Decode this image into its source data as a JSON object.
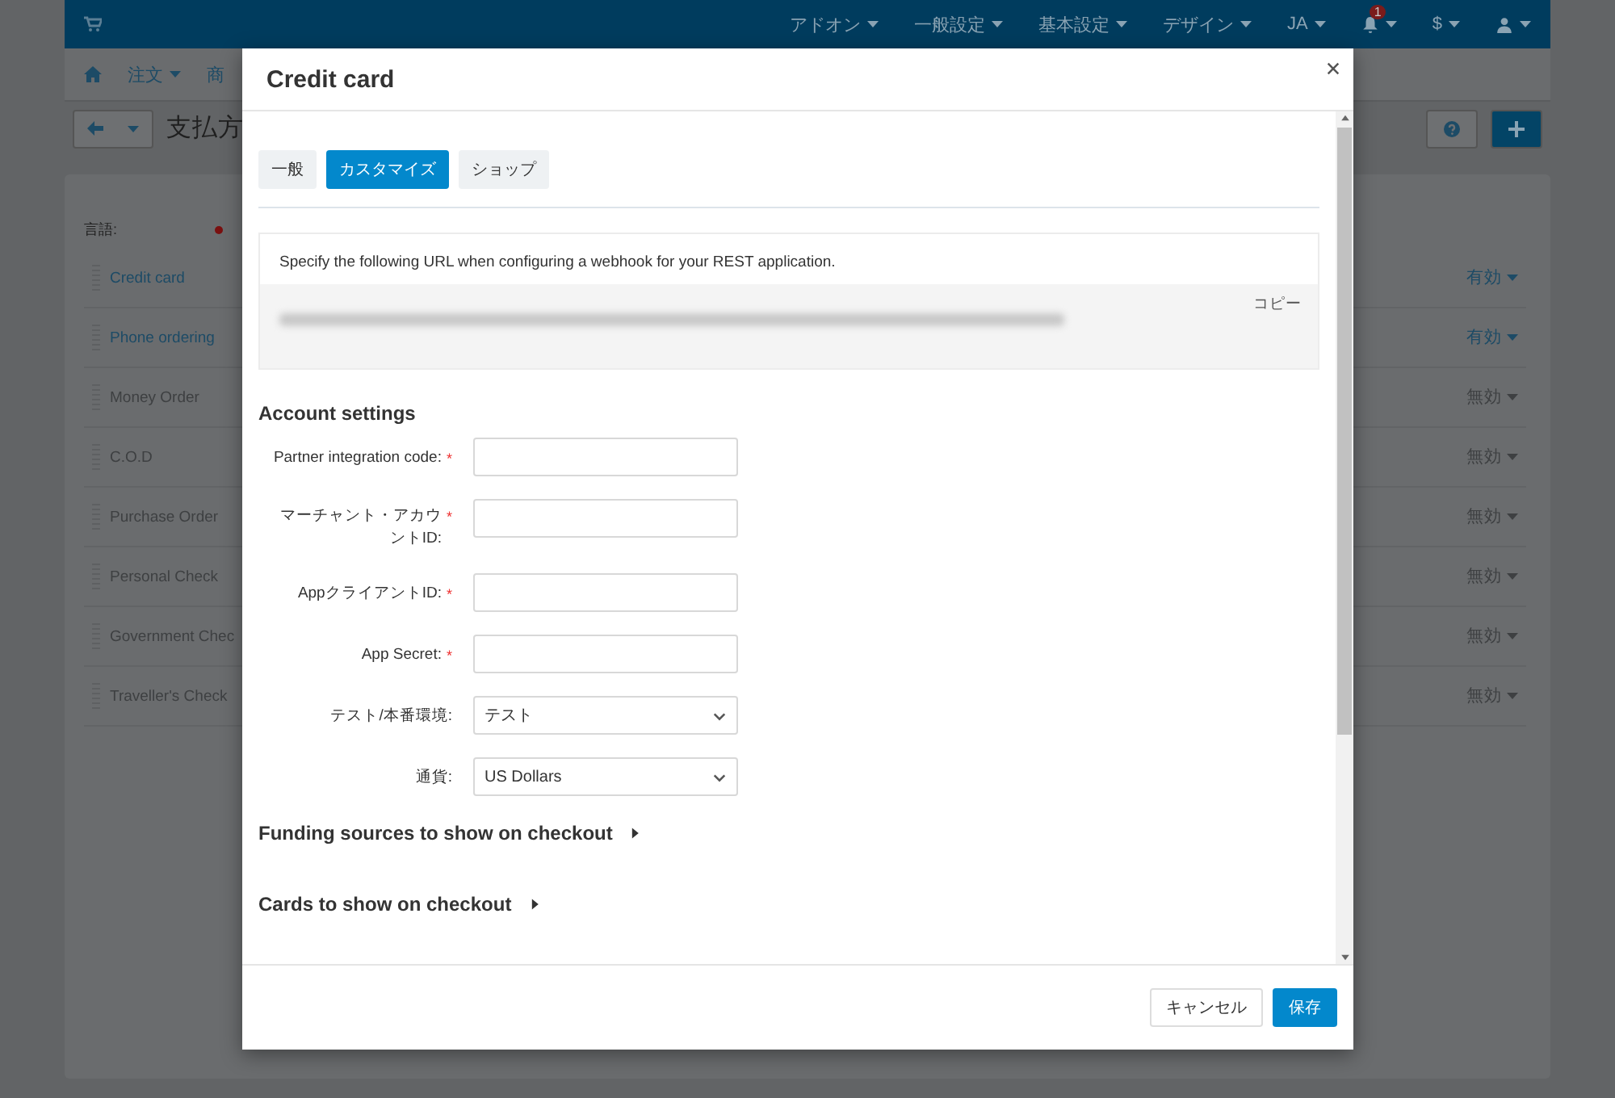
{
  "top_bar": {
    "menus": [
      {
        "kind": "text",
        "label": "アドオン"
      },
      {
        "kind": "text",
        "label": "一般設定"
      },
      {
        "kind": "text",
        "label": "基本設定"
      },
      {
        "kind": "text",
        "label": "デザイン"
      },
      {
        "kind": "text",
        "label": "JA"
      },
      {
        "kind": "bell",
        "badge": "1"
      },
      {
        "kind": "text",
        "label": "$"
      },
      {
        "kind": "user"
      }
    ]
  },
  "nav_bar": {
    "items": [
      "注文",
      "商"
    ]
  },
  "page": {
    "title": "支払方"
  },
  "settings_panel": {
    "label": "言語:"
  },
  "payment_methods": [
    {
      "name": "Credit card",
      "status": "有効",
      "active": true
    },
    {
      "name": "Phone ordering",
      "status": "有効",
      "active": true
    },
    {
      "name": "Money Order",
      "status": "無効",
      "active": false
    },
    {
      "name": "C.O.D",
      "status": "無効",
      "active": false
    },
    {
      "name": "Purchase Order",
      "status": "無効",
      "active": false
    },
    {
      "name": "Personal Check",
      "status": "無効",
      "active": false
    },
    {
      "name": "Government Chec",
      "status": "無効",
      "active": false
    },
    {
      "name": "Traveller's Check",
      "status": "無効",
      "active": false
    }
  ],
  "dialog": {
    "title": "Credit card",
    "tabs": [
      {
        "label": "一般",
        "selected": false
      },
      {
        "label": "カスタマイズ",
        "selected": true
      },
      {
        "label": "ショップ",
        "selected": false
      }
    ],
    "webhook": {
      "instruction": "Specify the following URL when configuring a webhook for your REST application.",
      "copy_label": "コピー"
    },
    "account_settings": {
      "heading": "Account settings",
      "fields": [
        {
          "kind": "input",
          "label": "Partner integration code:",
          "required_mark": "*"
        },
        {
          "kind": "input",
          "label": "マーチャント・アカウントID:",
          "required_mark": "*"
        },
        {
          "kind": "input",
          "label": "AppクライアントID:",
          "required_mark": "*"
        },
        {
          "kind": "input",
          "label": "App Secret:",
          "required_mark": "*"
        },
        {
          "kind": "select",
          "label": "テスト/本番環境:",
          "value": "テスト"
        },
        {
          "kind": "select",
          "label": "通貨:",
          "value": "US Dollars"
        }
      ]
    },
    "sections": [
      {
        "title": "Funding sources to show on checkout",
        "expanded": false
      },
      {
        "title": "Cards to show on checkout",
        "expanded": false
      }
    ],
    "buttons": [
      {
        "kind": "secondary",
        "label": "キャンセル"
      },
      {
        "kind": "primary",
        "label": "保存"
      }
    ]
  }
}
